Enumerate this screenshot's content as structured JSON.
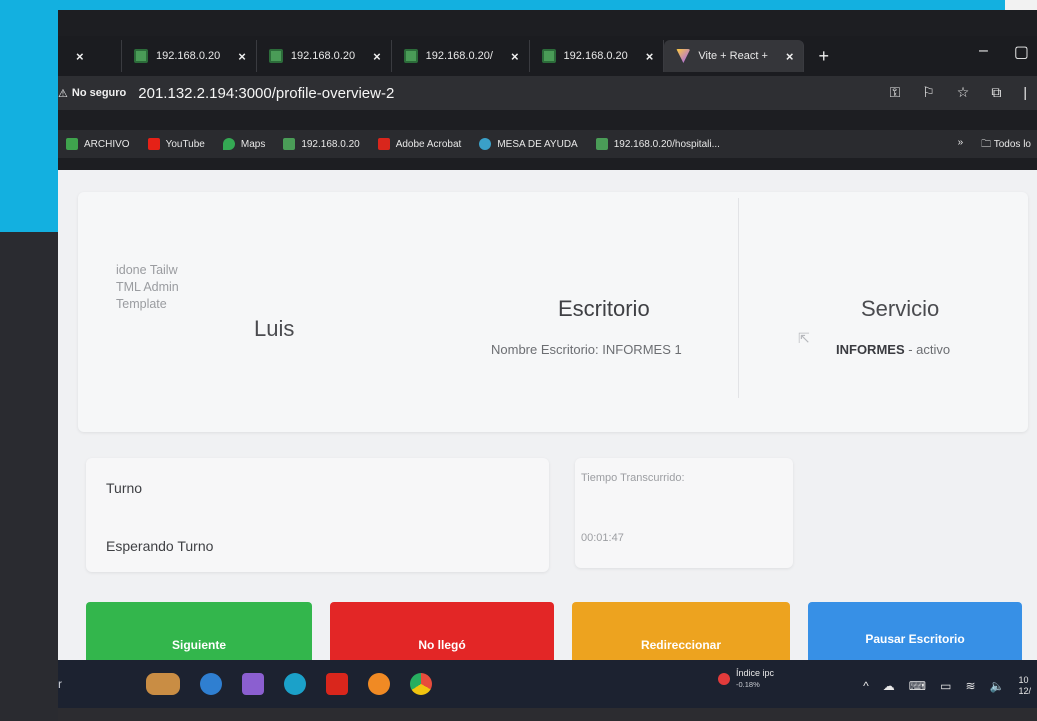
{
  "browser": {
    "tabs": [
      {
        "label": "",
        "close": "×"
      },
      {
        "label": "192.168.0.20",
        "close": "×"
      },
      {
        "label": "192.168.0.20",
        "close": "×"
      },
      {
        "label": "192.168.0.20/",
        "close": "×"
      },
      {
        "label": "192.168.0.20",
        "close": "×"
      },
      {
        "label": "Vite + React +",
        "close": "×",
        "active": true
      }
    ],
    "new_tab": "+",
    "minimize": "–",
    "security_label": "No seguro",
    "url": "201.132.2.194:3000/profile-overview-2"
  },
  "bookmarks": [
    {
      "label": "ARCHIVO",
      "color": "#3fa34d"
    },
    {
      "label": "YouTube",
      "color": "#e62117"
    },
    {
      "label": "Maps",
      "color": "#34a853"
    },
    {
      "label": "192.168.0.20",
      "color": "#4a9c57"
    },
    {
      "label": "Adobe Acrobat",
      "color": "#d9261c"
    },
    {
      "label": "MESA DE AYUDA",
      "color": "#3aa0c8"
    },
    {
      "label": "192.168.0.20/hospitali...",
      "color": "#4a9c57"
    }
  ],
  "bookmarks_more": "»",
  "bookmarks_all": "Todos lo",
  "page": {
    "template_text": [
      "idone Tailw",
      "TML Admin",
      "Template"
    ],
    "user_name": "Luis",
    "desk": {
      "title": "Escritorio",
      "name_text": "Nombre Escritorio: INFORMES 1"
    },
    "service": {
      "title": "Servicio",
      "name": "INFORMES",
      "status_suffix": " - activo"
    },
    "turn": {
      "label": "Turno",
      "status": "Esperando Turno"
    },
    "timer": {
      "label": "Tiempo Transcurrido:",
      "value": "00:01:47"
    },
    "buttons": {
      "next": "Siguiente",
      "no_show": "No llegó",
      "redirect": "Redireccionar",
      "pause": "Pausar Escritorio"
    }
  },
  "taskbar": {
    "search_hint": "r",
    "news_title": "Índice ipc",
    "news_value": "-0.18%",
    "clock_time": "10",
    "clock_date": "12/"
  },
  "colors": {
    "accent_cyan": "#13b0e0",
    "next": "#33b64c",
    "no_show": "#e32626",
    "redirect": "#eda31f",
    "pause": "#3790e6"
  }
}
